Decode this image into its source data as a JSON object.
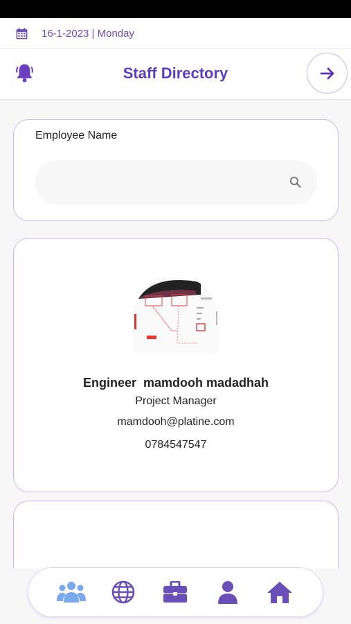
{
  "datebar": {
    "date": "16-1-2023 | Monday",
    "icon": "calendar-icon"
  },
  "header": {
    "title": "Staff Directory",
    "bell_icon": "bell-icon",
    "next_icon": "arrow-right-icon"
  },
  "search": {
    "label": "Employee Name",
    "value": "",
    "placeholder": "",
    "icon": "search-icon"
  },
  "employees": [
    {
      "name": "Engineer  mamdooh madadhah",
      "role": "Project Manager",
      "email": "mamdooh@platine.com",
      "phone": "0784547547"
    }
  ],
  "nav": [
    {
      "name": "team",
      "icon": "users-icon"
    },
    {
      "name": "web",
      "icon": "globe-icon"
    },
    {
      "name": "work",
      "icon": "briefcase-icon"
    },
    {
      "name": "profile",
      "icon": "user-icon"
    },
    {
      "name": "home",
      "icon": "home-icon"
    }
  ],
  "colors": {
    "accent": "#5e3ec0",
    "date": "#6f4ab8",
    "nav_active": "#7aa9ee",
    "nav_icon": "#6a4fb8",
    "border": "#c9b8ec"
  }
}
